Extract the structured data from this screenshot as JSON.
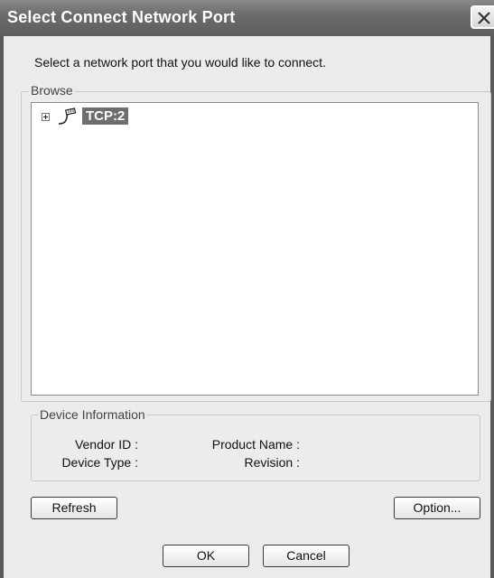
{
  "window": {
    "title": "Select Connect Network Port",
    "close_icon": "close-icon"
  },
  "instruction": "Select a network port that you would like to connect.",
  "browse": {
    "legend": "Browse",
    "tree": [
      {
        "label": "TCP:2",
        "icon": "network-cable-icon",
        "expanded": false,
        "selected": true
      }
    ]
  },
  "device_info": {
    "legend": "Device Information",
    "vendor_id_label": "Vendor ID :",
    "device_type_label": "Device Type :",
    "product_name_label": "Product Name :",
    "revision_label": "Revision :"
  },
  "buttons": {
    "refresh": "Refresh",
    "option": "Option...",
    "ok": "OK",
    "cancel": "Cancel"
  }
}
